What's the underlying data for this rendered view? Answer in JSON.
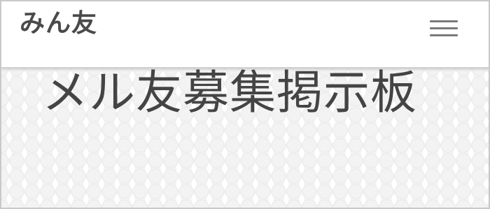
{
  "header": {
    "logo_text": "みん友",
    "menu_icon": "hamburger-menu-icon"
  },
  "hero": {
    "title": "メル友募集掲示板"
  },
  "colors": {
    "text": "#4a4a4a",
    "hero_text": "#444444",
    "hero_bg": "#f3f3f3",
    "border": "#c9c9c9"
  }
}
